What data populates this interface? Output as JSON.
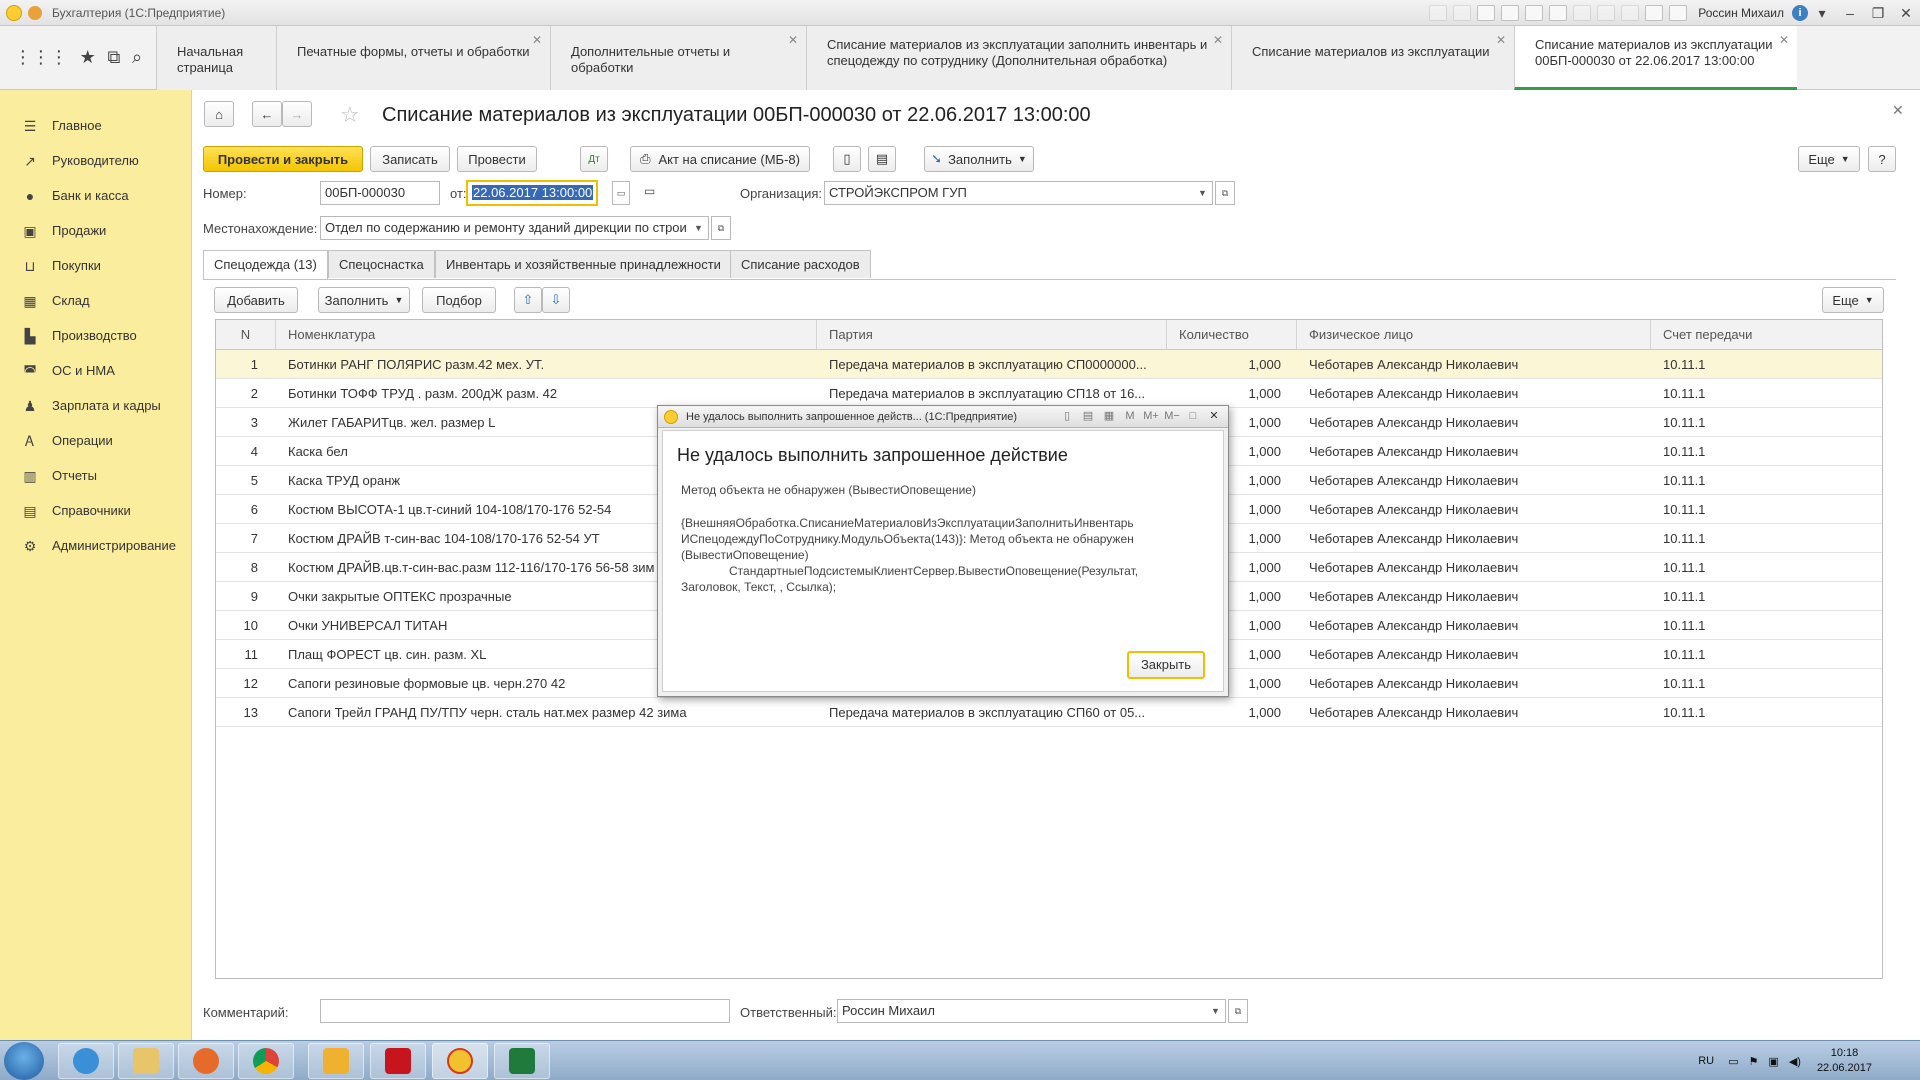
{
  "window": {
    "title": "Бухгалтерия  (1С:Предприятие)",
    "user": "Россин Михаил"
  },
  "tabs": [
    {
      "label": "Начальная страница",
      "closable": false
    },
    {
      "label": "Печатные формы, отчеты и обработки",
      "closable": true
    },
    {
      "label": "Дополнительные отчеты и обработки",
      "closable": true
    },
    {
      "label": "Списание материалов из эксплуатации заполнить инвентарь и спецодежду по сотруднику (Дополнительная обработка)",
      "closable": true
    },
    {
      "label": "Списание материалов из эксплуатации",
      "closable": true
    },
    {
      "label": "Списание материалов из эксплуатации 00БП-000030 от 22.06.2017 13:00:00",
      "closable": true,
      "active": true
    }
  ],
  "sidebar": {
    "items": [
      {
        "label": "Главное",
        "icon": "menu-icon"
      },
      {
        "label": "Руководителю",
        "icon": "chart-line-icon"
      },
      {
        "label": "Банк и касса",
        "icon": "coin-icon"
      },
      {
        "label": "Продажи",
        "icon": "shopping-bag-icon"
      },
      {
        "label": "Покупки",
        "icon": "cart-icon"
      },
      {
        "label": "Склад",
        "icon": "warehouse-icon"
      },
      {
        "label": "Производство",
        "icon": "factory-icon"
      },
      {
        "label": "ОС и НМА",
        "icon": "car-icon"
      },
      {
        "label": "Зарплата и кадры",
        "icon": "person-icon"
      },
      {
        "label": "Операции",
        "icon": "operations-icon"
      },
      {
        "label": "Отчеты",
        "icon": "bar-chart-icon"
      },
      {
        "label": "Справочники",
        "icon": "book-icon"
      },
      {
        "label": "Администрирование",
        "icon": "gear-icon"
      }
    ]
  },
  "document": {
    "title": "Списание материалов из эксплуатации 00БП-000030 от 22.06.2017 13:00:00",
    "toolbar": {
      "post_close": "Провести и закрыть",
      "save": "Записать",
      "post": "Провести",
      "act": "Акт на списание (МБ-8)",
      "fill": "Заполнить",
      "more": "Еще",
      "help": "?"
    },
    "number_label": "Номер:",
    "number": "00БП-000030",
    "date_label": "от:",
    "date": "22.06.2017 13:00:00",
    "org_label": "Организация:",
    "org": "СТРОЙЭКСПРОМ ГУП",
    "location_label": "Местонахождение:",
    "location": "Отдел по содержанию и ремонту зданий дирекции по строи",
    "form_tabs": [
      "Спецодежда (13)",
      "Спецоснастка",
      "Инвентарь и хозяйственные принадлежности",
      "Списание расходов"
    ],
    "table_toolbar": {
      "add": "Добавить",
      "fill": "Заполнить",
      "pick": "Подбор",
      "more": "Еще"
    },
    "columns": [
      "N",
      "Номенклатура",
      "Партия",
      "Количество",
      "Физическое лицо",
      "Счет передачи"
    ],
    "rows": [
      {
        "n": "1",
        "item": "Ботинки РАНГ ПОЛЯРИС   разм.42 мех. УТ.",
        "batch": "Передача материалов в эксплуатацию СП0000000...",
        "qty": "1,000",
        "person": "Чеботарев Александр Николаевич",
        "account": "10.11.1"
      },
      {
        "n": "2",
        "item": "Ботинки ТОФФ ТРУД  . разм. 200дЖ   разм. 42",
        "batch": "Передача материалов в эксплуатацию СП18 от 16...",
        "qty": "1,000",
        "person": "Чеботарев Александр Николаевич",
        "account": "10.11.1"
      },
      {
        "n": "3",
        "item": "Жилет ГАБАРИТцв. жел. размер   L",
        "batch": "",
        "qty": "1,000",
        "person": "Чеботарев Александр Николаевич",
        "account": "10.11.1"
      },
      {
        "n": "4",
        "item": "Каска  бел",
        "batch": "",
        "qty": "1,000",
        "person": "Чеботарев Александр Николаевич",
        "account": "10.11.1"
      },
      {
        "n": "5",
        "item": "Каска ТРУД оранж",
        "batch": "",
        "qty": "1,000",
        "person": "Чеботарев Александр Николаевич",
        "account": "10.11.1"
      },
      {
        "n": "6",
        "item": "Костюм ВЫСОТА-1  цв.т-синий 104-108/170-176  52-54",
        "batch": "",
        "qty": "1,000",
        "person": "Чеботарев Александр Николаевич",
        "account": "10.11.1"
      },
      {
        "n": "7",
        "item": "Костюм ДРАЙВ т-син-вас 104-108/170-176 52-54 УТ",
        "batch": "",
        "qty": "1,000",
        "person": "Чеботарев Александр Николаевич",
        "account": "10.11.1"
      },
      {
        "n": "8",
        "item": "Костюм ДРАЙВ.цв.т-син-вас.разм 112-116/170-176  56-58 зим",
        "batch": "",
        "qty": "1,000",
        "person": "Чеботарев Александр Николаевич",
        "account": "10.11.1"
      },
      {
        "n": "9",
        "item": "Очки  закрытые ОПТЕКС  прозрачные",
        "batch": "",
        "qty": "1,000",
        "person": "Чеботарев Александр Николаевич",
        "account": "10.11.1"
      },
      {
        "n": "10",
        "item": "Очки  УНИВЕРСАЛ ТИТАН",
        "batch": "",
        "qty": "1,000",
        "person": "Чеботарев Александр Николаевич",
        "account": "10.11.1"
      },
      {
        "n": "11",
        "item": "Плащ ФОРЕСТ цв. син. разм. XL",
        "batch": "",
        "qty": "1,000",
        "person": "Чеботарев Александр Николаевич",
        "account": "10.11.1"
      },
      {
        "n": "12",
        "item": "Сапоги резиновые   формовые  цв. черн.270 42",
        "batch": "",
        "qty": "1,000",
        "person": "Чеботарев Александр Николаевич",
        "account": "10.11.1"
      },
      {
        "n": "13",
        "item": "Сапоги Трейл ГРАНД  ПУ/ТПУ  черн. сталь нат.мех размер 42 зима",
        "batch": "Передача материалов в эксплуатацию СП60 от 05...",
        "qty": "1,000",
        "person": "Чеботарев Александр Николаевич",
        "account": "10.11.1"
      }
    ],
    "comment_label": "Комментарий:",
    "comment": "",
    "responsible_label": "Ответственный:",
    "responsible": "Россин Михаил"
  },
  "dialog": {
    "window_title": "Не удалось выполнить запрошенное действ...  (1С:Предприятие)",
    "heading": "Не удалось выполнить запрошенное действие",
    "message": "Метод объекта не обнаружен (ВывестиОповещение)",
    "detail_1": "{ВнешняяОбработка.СписаниеМатериаловИзЭксплуатацииЗаполнитьИнвентарь",
    "detail_2": "ИСпецодеждуПоСотруднику.МодульОбъекта(143)}: Метод объекта не обнаружен",
    "detail_3": "(ВывестиОповещение)",
    "detail_4": "СтандартныеПодсистемыКлиентСервер.ВывестиОповещение(Результат,",
    "detail_5": "Заголовок, Текст, , Ссылка);",
    "close": "Закрыть"
  },
  "taskbar": {
    "lang": "RU",
    "time": "10:18",
    "date": "22.06.2017",
    "apps": [
      "ie",
      "explorer",
      "media",
      "chrome",
      "outlook",
      "acrobat",
      "1c",
      "excel"
    ]
  },
  "colors": {
    "sidebar_bg": "#fbed9e",
    "primary_button": "#f4c500",
    "active_tab_accent": "#3a9a4a",
    "selected_row": "#fbf6d5",
    "date_selection": "#3568b6"
  }
}
